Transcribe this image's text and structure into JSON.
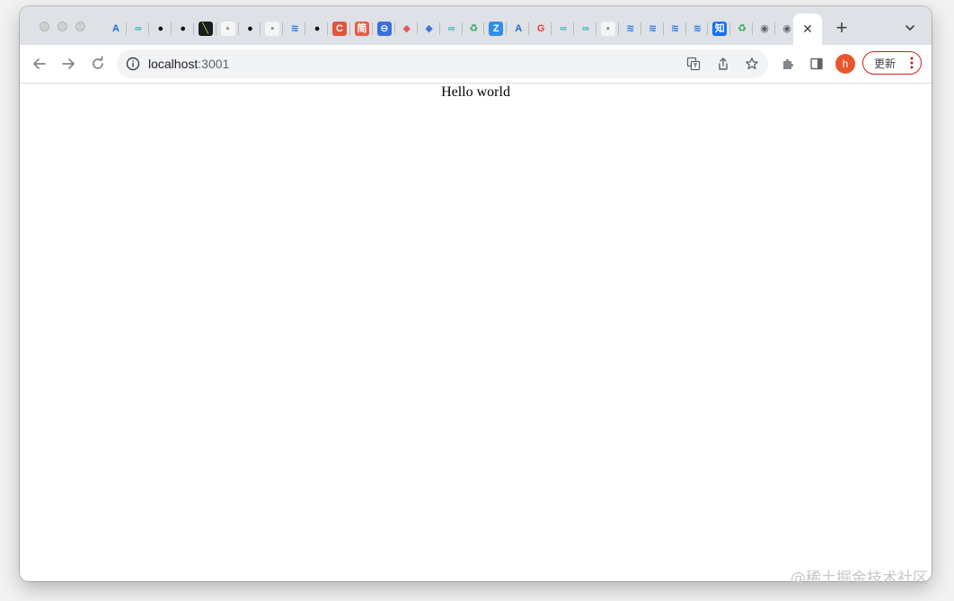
{
  "browser": {
    "active_tab_close": "✕",
    "new_tab": "+",
    "address": {
      "host": "localhost",
      "port": ":3001"
    },
    "profile_initial": "h",
    "update_label": "更新",
    "accent": "#c5221f",
    "avatar_color": "#e8572b"
  },
  "tabs": [
    {
      "icon": "azure-icon",
      "glyph": "A",
      "bg": "transparent",
      "fg": "#1e6bd6"
    },
    {
      "icon": "link-icon",
      "glyph": "∞",
      "bg": "transparent",
      "fg": "#2bb5c8"
    },
    {
      "icon": "github-icon",
      "glyph": "●",
      "bg": "transparent",
      "fg": "#111"
    },
    {
      "icon": "github-icon",
      "glyph": "●",
      "bg": "transparent",
      "fg": "#111"
    },
    {
      "icon": "vim-icon",
      "glyph": "╲",
      "bg": "#1b1b1b",
      "fg": "#9be34a"
    },
    {
      "icon": "doc-icon",
      "glyph": "▪",
      "bg": "#f5f5f5",
      "fg": "#888"
    },
    {
      "icon": "github-icon",
      "glyph": "●",
      "bg": "transparent",
      "fg": "#111"
    },
    {
      "icon": "doc-icon",
      "glyph": "▪",
      "bg": "#f5f5f5",
      "fg": "#888"
    },
    {
      "icon": "layers-icon",
      "glyph": "≋",
      "bg": "transparent",
      "fg": "#2e77e5"
    },
    {
      "icon": "github-icon",
      "glyph": "●",
      "bg": "transparent",
      "fg": "#111"
    },
    {
      "icon": "c-icon",
      "glyph": "C",
      "bg": "#e2553b",
      "fg": "#fff"
    },
    {
      "icon": "jian-icon",
      "glyph": "简",
      "bg": "#e95c44",
      "fg": "#fff"
    },
    {
      "icon": "box-icon",
      "glyph": "⊖",
      "bg": "#3d6ee0",
      "fg": "#fff"
    },
    {
      "icon": "diamond-icon",
      "glyph": "◆",
      "bg": "transparent",
      "fg": "#e05a5a"
    },
    {
      "icon": "diamond-icon",
      "glyph": "◆",
      "bg": "transparent",
      "fg": "#3a7be0"
    },
    {
      "icon": "link-icon",
      "glyph": "∞",
      "bg": "transparent",
      "fg": "#2bb5c8"
    },
    {
      "icon": "recycle-icon",
      "glyph": "♻",
      "bg": "transparent",
      "fg": "#2fa84f"
    },
    {
      "icon": "z-icon",
      "glyph": "Z",
      "bg": "#2f8fe8",
      "fg": "#fff"
    },
    {
      "icon": "azure-icon",
      "glyph": "A",
      "bg": "transparent",
      "fg": "#1e6bd6"
    },
    {
      "icon": "google-icon",
      "glyph": "G",
      "bg": "transparent",
      "fg": "#e94235"
    },
    {
      "icon": "link-icon",
      "glyph": "∞",
      "bg": "transparent",
      "fg": "#2bb5c8"
    },
    {
      "icon": "link-icon",
      "glyph": "∞",
      "bg": "transparent",
      "fg": "#2bb5c8"
    },
    {
      "icon": "doc-icon",
      "glyph": "▪",
      "bg": "#f5f5f5",
      "fg": "#888"
    },
    {
      "icon": "layers-icon",
      "glyph": "≋",
      "bg": "transparent",
      "fg": "#2e77e5"
    },
    {
      "icon": "layers-icon",
      "glyph": "≋",
      "bg": "transparent",
      "fg": "#2e77e5"
    },
    {
      "icon": "layers-icon",
      "glyph": "≋",
      "bg": "transparent",
      "fg": "#2e77e5"
    },
    {
      "icon": "layers-icon",
      "glyph": "≋",
      "bg": "transparent",
      "fg": "#2e77e5"
    },
    {
      "icon": "zhihu-icon",
      "glyph": "知",
      "bg": "#1772f6",
      "fg": "#fff"
    },
    {
      "icon": "recycle-icon",
      "glyph": "♻",
      "bg": "transparent",
      "fg": "#2fa84f"
    },
    {
      "icon": "globe-icon",
      "glyph": "◉",
      "bg": "transparent",
      "fg": "#5f6368"
    },
    {
      "icon": "globe-icon",
      "glyph": "◉",
      "bg": "transparent",
      "fg": "#5f6368"
    }
  ],
  "page": {
    "heading": "Hello world"
  },
  "watermark": "@稀土掘金技术社区"
}
